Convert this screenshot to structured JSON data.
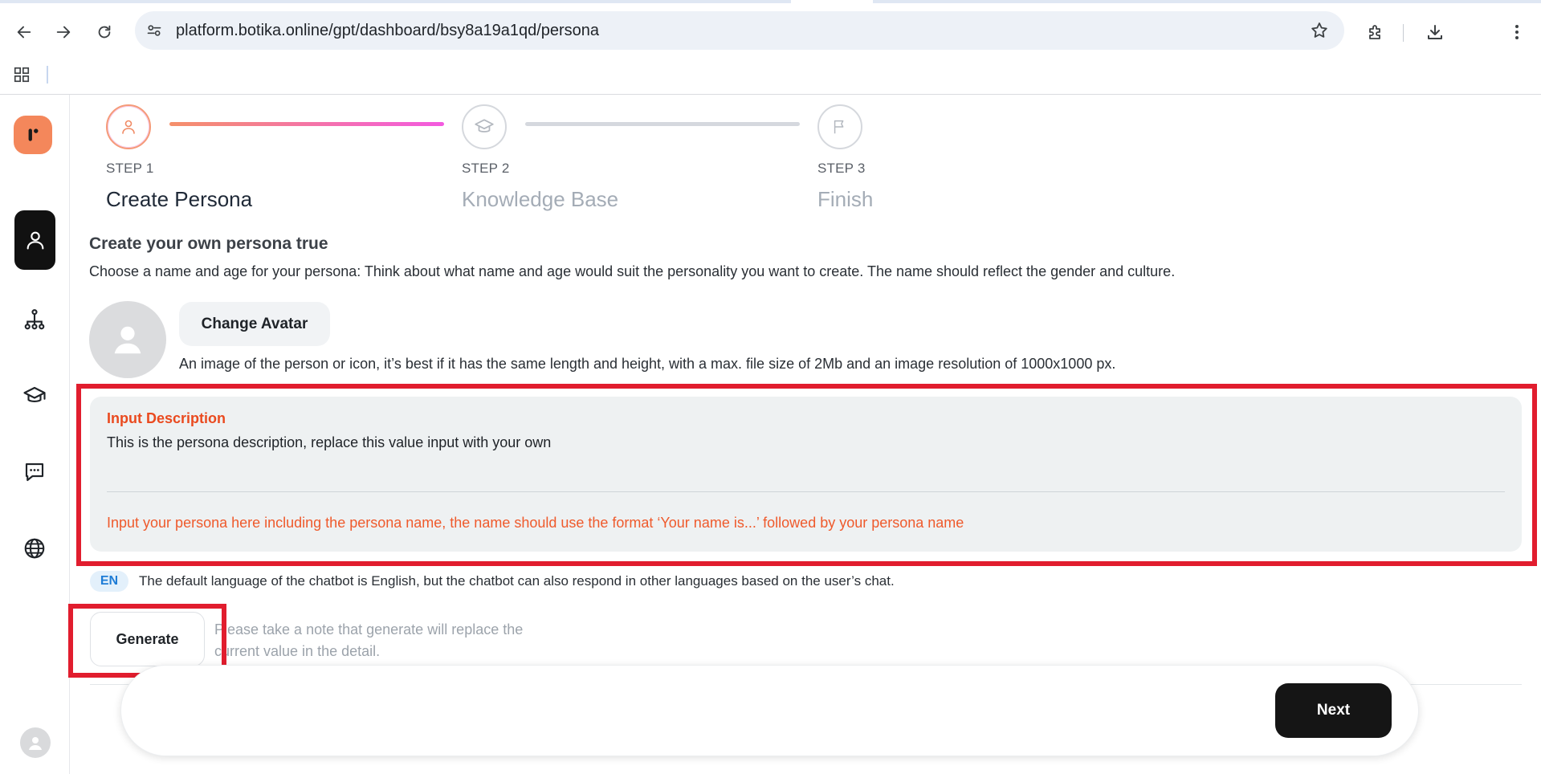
{
  "browser": {
    "url": "platform.botika.online/gpt/dashboard/bsy8a19a1qd/persona",
    "icons": [
      "back-icon",
      "forward-icon",
      "reload-icon",
      "site-info-icon",
      "bookmark-star-icon",
      "extensions-icon",
      "download-icon",
      "menu-icon",
      "apps-icon"
    ]
  },
  "sidebar": {
    "items": [
      {
        "name": "persona",
        "icon": "user-icon",
        "active": true
      },
      {
        "name": "integration",
        "icon": "hierarchy-icon",
        "active": false
      },
      {
        "name": "knowledge",
        "icon": "graduation-cap-icon",
        "active": false
      },
      {
        "name": "chat",
        "icon": "chat-bubble-icon",
        "active": false
      },
      {
        "name": "web",
        "icon": "globe-icon",
        "active": false
      }
    ]
  },
  "steps": [
    {
      "number": "STEP 1",
      "title": "Create Persona",
      "icon": "user-icon",
      "state": "active"
    },
    {
      "number": "STEP 2",
      "title": "Knowledge Base",
      "icon": "graduation-cap-icon",
      "state": "inactive"
    },
    {
      "number": "STEP 3",
      "title": "Finish",
      "icon": "flag-icon",
      "state": "inactive"
    }
  ],
  "persona": {
    "title": "Create your own persona true",
    "description": "Choose a name and age for your persona: Think about what name and age would suit the personality you want to create. The name should reflect the gender and culture.",
    "change_avatar_label": "Change Avatar",
    "avatar_note": "An image of the person or icon, it’s best if it has the same length and height, with a max. file size of 2Mb and an image resolution of 1000x1000 px."
  },
  "input_description": {
    "label": "Input Description",
    "value": "This is the persona description, replace this value input with your own",
    "hint": "Input your persona here including the persona name, the name should use the format ‘Your name is...’ followed by your persona name"
  },
  "language": {
    "badge": "EN",
    "note": "The default language of the chatbot is English, but the chatbot can also respond in other languages based on the user’s chat."
  },
  "generate": {
    "label": "Generate",
    "note": "Please take a note that generate will replace the current value in the detail."
  },
  "footer": {
    "next_label": "Next"
  },
  "colors": {
    "accent_orange": "#f4875b",
    "highlight_red": "#e11d2e",
    "hint_orange": "#ef5a2c",
    "progress_gradient_start": "#f5906a",
    "progress_gradient_end": "#f35ae0"
  }
}
